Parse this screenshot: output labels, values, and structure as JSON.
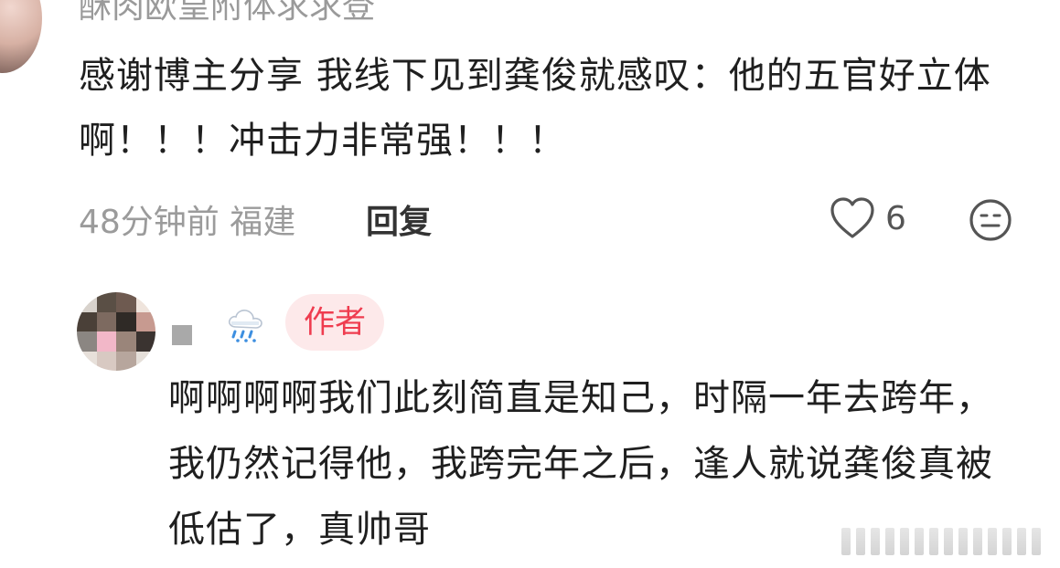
{
  "comment": {
    "username": "酥肉欧皇附体求求登",
    "text": "感谢博主分享 我线下见到龚俊就感叹：他的五官好立体啊！！！冲击力非常强！！！",
    "time": "48分钟前",
    "location": "福建",
    "reply_label": "回复",
    "like_count": "6",
    "icons": [
      "heart-outline-icon",
      "neutral-face-icon"
    ]
  },
  "reply": {
    "weather_icon": "rain-cloud-icon",
    "author_badge": "作者",
    "text": "啊啊啊啊我们此刻简直是知己，时隔一年去跨年，我仍然记得他，我跨完年之后，逢人就说龚俊真被低估了，真帅哥"
  },
  "colors": {
    "text": "#1f1f1f",
    "meta": "#9b9b9b",
    "badge_bg": "#fde9ea",
    "badge_text": "#ef3c4f"
  }
}
